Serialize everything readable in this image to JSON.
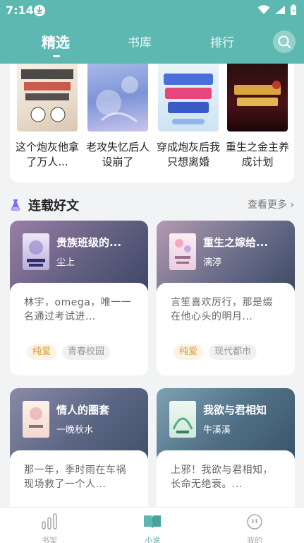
{
  "status_bar": {
    "time": "7:14"
  },
  "tabs": [
    {
      "label": "精选"
    },
    {
      "label": "书库"
    },
    {
      "label": "排行"
    }
  ],
  "strip_books": [
    {
      "title": "这个炮灰他拿了万人..."
    },
    {
      "title": "老攻失忆后人设崩了"
    },
    {
      "title": "穿成炮灰后我只想离婚"
    },
    {
      "title": "重生之金主养成计划"
    }
  ],
  "section": {
    "title": "连载好文",
    "more": "查看更多"
  },
  "serial_books": [
    {
      "title": "贵族班级的...",
      "author": "尘上",
      "desc": "林宇，omega，唯一一名通过考试进...",
      "tags": [
        "纯爱",
        "青春校园"
      ]
    },
    {
      "title": "重生之嫁给...",
      "author": "漓渟",
      "desc": "言笙喜欢厉行，那是缀在他心头的明月...",
      "tags": [
        "纯爱",
        "现代都市"
      ]
    },
    {
      "title": "情人的圈套",
      "author": "一晚秋水",
      "desc": "那一年，季时雨在车祸现场救了一个人..."
    },
    {
      "title": "我欲与君相知",
      "author": "牛溪溪",
      "desc": "上邪！我欲与君相知，长命无绝衰。..."
    }
  ],
  "bottom_nav": [
    {
      "label": "书架"
    },
    {
      "label": "小说"
    },
    {
      "label": "我的"
    }
  ],
  "colors": {
    "accent": "#5cb8b0",
    "tag_primary": "#d89b40"
  }
}
